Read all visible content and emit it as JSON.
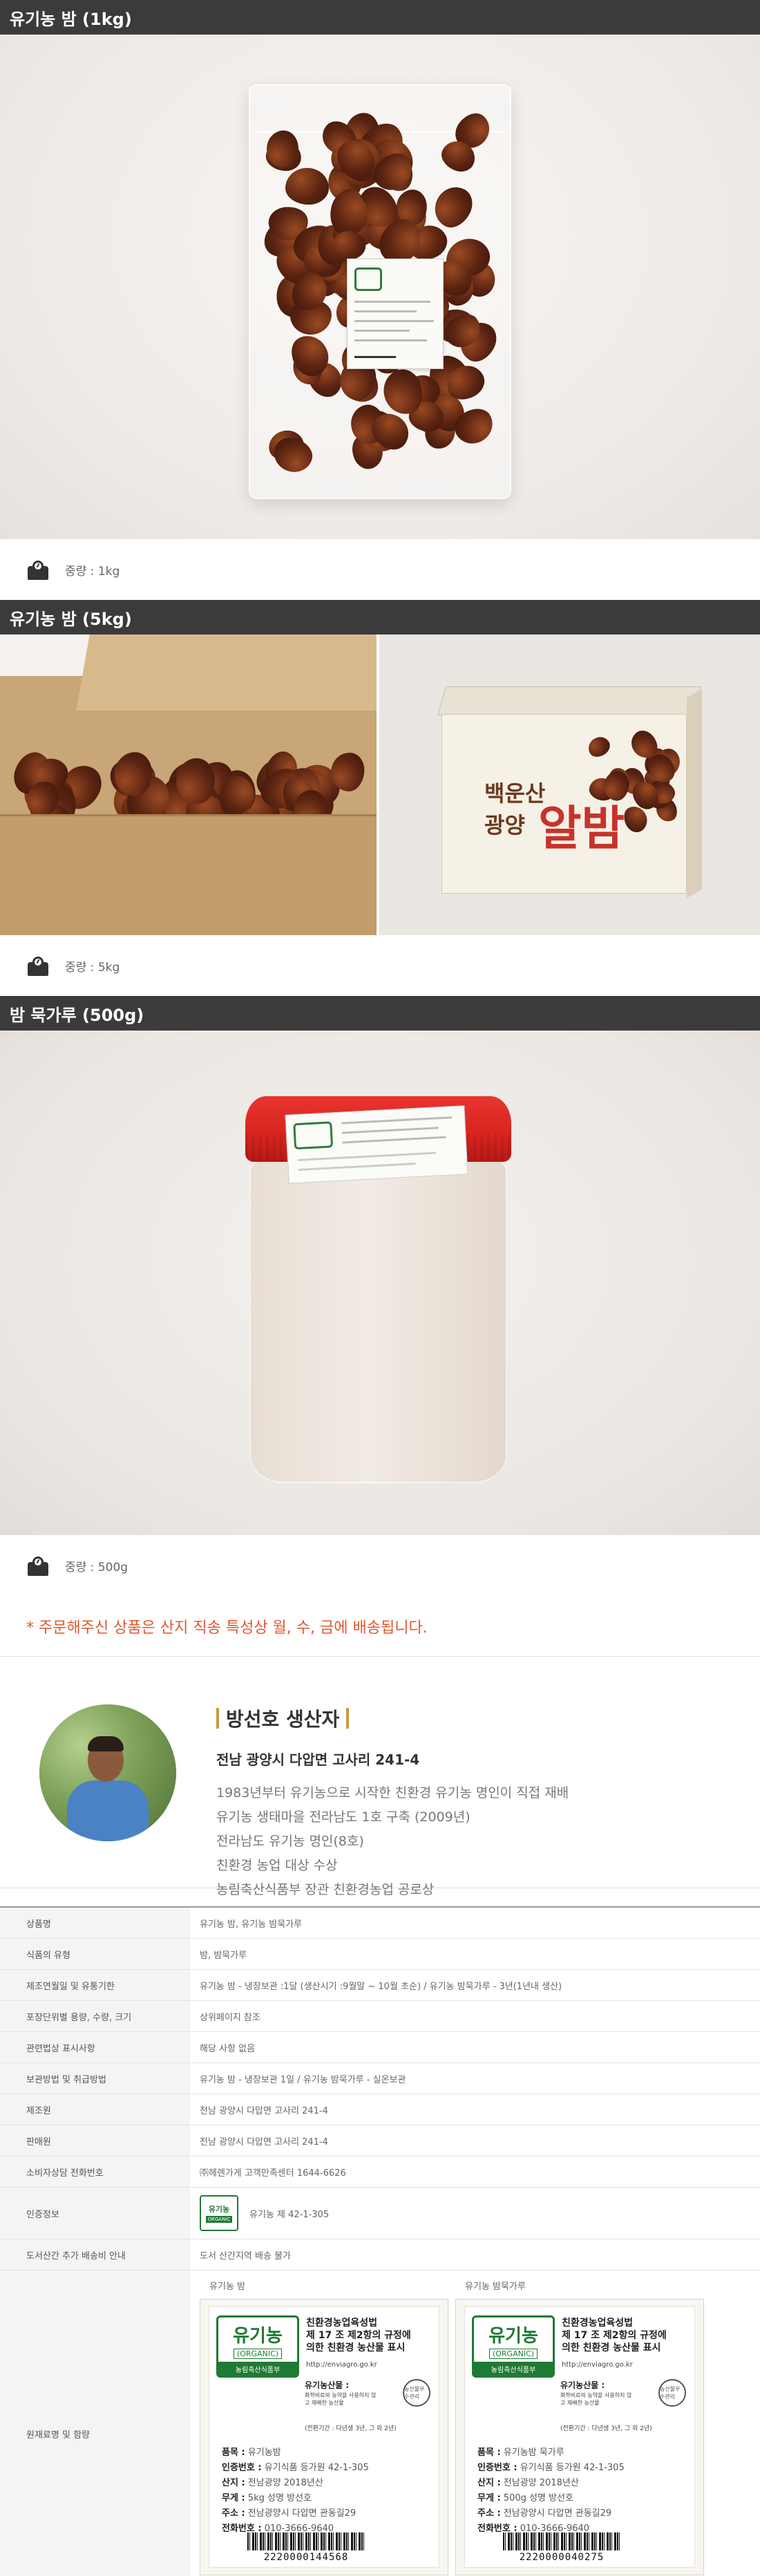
{
  "sections": [
    {
      "title": "유기농 밤 (1kg)",
      "weight_caption": "중량 : 1kg"
    },
    {
      "title": "유기농 밤 (5kg)",
      "weight_caption": "중량 : 5kg",
      "gift_box_line1": "백운산",
      "gift_box_line2": "광양",
      "gift_box_big": "알밤"
    },
    {
      "title": "밤 묵가루 (500g)",
      "weight_caption": "중량 : 500g"
    }
  ],
  "notice": "* 주문해주신 상품은 산지 직송 특성상 월, 수, 금에 배송됩니다.",
  "producer": {
    "name": "방선호 생산자",
    "address": "전남 광양시 다압면 고사리 241-4",
    "lines": [
      "1983년부터 유기농으로 시작한 친환경 유기농 명인이 직접 재배",
      "유기농 생태마을 전라남도 1호 구축 (2009년)",
      "전라남도 유기농 명인(8호)",
      "친환경 농업 대상 수상",
      "농림축산식품부 장관 친환경농업 공로상"
    ]
  },
  "info": [
    {
      "key": "상품명",
      "value": "유기농 밤, 유기농 밤묵가루"
    },
    {
      "key": "식품의 유형",
      "value": "밤, 밤묵가루"
    },
    {
      "key": "제조연월일 및 유통기한",
      "value": "유기농 밤 - 냉장보관 :1달 (생산시기 :9월말 ~ 10월 초순) / 유기농 밤묵가루 - 3년(1년내 생산)"
    },
    {
      "key": "포장단위별 용량, 수량, 크기",
      "value": "상위페이지 참조"
    },
    {
      "key": "관련법상 표시사항",
      "value": "해당 사항 없음"
    },
    {
      "key": "보관방법 및 취급방법",
      "value": "유기농 밤 - 냉장보관 1일 / 유기농 밤묵가루 - 실온보관"
    },
    {
      "key": "제조원",
      "value": "전남 광양시 다압면 고사리 241-4"
    },
    {
      "key": "판매원",
      "value": "전남 광양시 다압면 고사리 241-4"
    },
    {
      "key": "소비자상담 전화번호",
      "value": "㈜헤렌가게 고객만족센터 1644-6626"
    },
    {
      "key": "인증정보",
      "value": "유기농 제 42-1-305",
      "mark_title": "유기농",
      "mark_sub": "ORGANIC"
    },
    {
      "key": "도서산간 추가 배송비 안내",
      "value": "도서 산간지역 배송 불가"
    },
    {
      "key": "원재료명 및 함량",
      "value": ""
    }
  ],
  "labels": [
    {
      "name": "유기농 밤",
      "logo": "유기농",
      "logo_en": "(ORGANIC)",
      "logo_gov": "농림축산식품부",
      "law": [
        "친환경농업육성법",
        "제 17 조 제2항의 규정에",
        "의한 친환경 농산물 표시"
      ],
      "url": "http://enviagro.go.kr",
      "producer_title": "유기농산물 :",
      "producer_note": "화학비료와 농약을 사용하지 않고 재배한 농산물",
      "cert_mark": "농산물우수관리",
      "note": "(전환기간 : 다년생 3년, 그 외 2년)",
      "fields": [
        [
          "품목 :",
          "유기농밤"
        ],
        [
          "인증번호 :",
          "유기식품 등가원 42-1-305"
        ],
        [
          "산지 :",
          "전남광양 2018년산"
        ],
        [
          "무게 :",
          "5kg     성명 방선호"
        ],
        [
          "주소 :",
          "전남광양시 다압면 관동길29"
        ],
        [
          "전화번호 :",
          "010-3666-9640"
        ]
      ],
      "barcode": "2220000144568"
    },
    {
      "name": "유기농 밤묵가루",
      "logo": "유기농",
      "logo_en": "(ORGANIC)",
      "logo_gov": "농림축산식품부",
      "law": [
        "친환경농업육성법",
        "제 17 조 제2항의 규정에",
        "의한 친환경 농산물 표시"
      ],
      "url": "http://enviagro.go.kr",
      "producer_title": "유기농산물 :",
      "producer_note": "화학비료와 농약을 사용하지 않고 재배한 농산물",
      "cert_mark": "농산물우수관리",
      "note": "(전환기간 : 다년생 3년, 그 외 2년)",
      "fields": [
        [
          "품목 :",
          "유기농밤 묵가루"
        ],
        [
          "인증번호 :",
          "유기식품 등가원 42-1-305"
        ],
        [
          "산지 :",
          "전남광양 2018년산"
        ],
        [
          "무게 :",
          "500g     성명 방선호"
        ],
        [
          "주소 :",
          "전남광양시 다압면 관동길29"
        ],
        [
          "전화번호 :",
          "010-3666-9640"
        ]
      ],
      "barcode": "2220000040275"
    }
  ]
}
